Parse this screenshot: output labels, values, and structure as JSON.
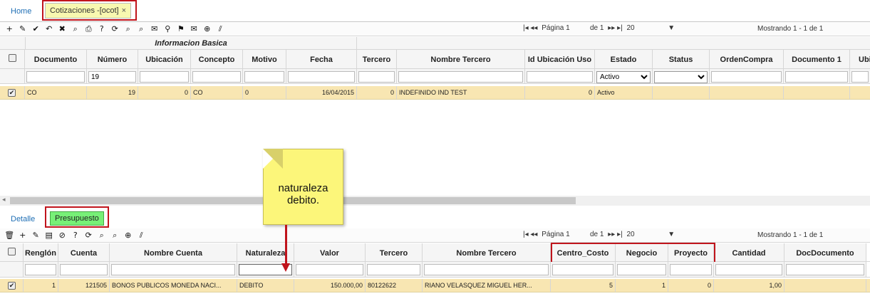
{
  "tabs": {
    "home": "Home",
    "active": "Cotizaciones -[ocot]",
    "close": "×"
  },
  "toolbar1": {
    "icons": [
      "+",
      "✎",
      "✔",
      "↶",
      "✖",
      "⌕",
      "⎙",
      "?",
      "⟳",
      "⌕",
      "⌕",
      "✉",
      "⚲",
      "⚑",
      "✉",
      "⊕",
      "⫽"
    ],
    "icon_names": [
      "add-icon",
      "edit-icon",
      "save-icon",
      "undo-icon",
      "delete-icon",
      "search-icon",
      "print-icon",
      "help-icon",
      "refresh-icon",
      "zoom-in-icon",
      "zoom-out-icon",
      "comment-icon",
      "user-icon",
      "pin-icon",
      "mail-icon",
      "plus-circle-icon",
      "slash-icon"
    ],
    "pager_first": "|◂ ◂◂",
    "pagina": "Página 1",
    "de": "de 1",
    "pager_next": "▸▸ ▸|",
    "page_size": "20",
    "dropdown": "▼",
    "showing": "Mostrando 1 - 1 de 1"
  },
  "main_grid": {
    "group_header": "Informacion Basica",
    "columns": [
      "Documento",
      "Número",
      "Ubicación",
      "Concepto",
      "Motivo",
      "Fecha",
      "Tercero",
      "Nombre Tercero",
      "Id Ubicación Uso",
      "Estado",
      "Status",
      "OrdenCompra",
      "Documento 1",
      "Ubi"
    ],
    "filters": {
      "numero": "19",
      "estado": "Activo",
      "status": ""
    },
    "row": {
      "documento": "CO",
      "numero": "19",
      "ubicacion": "0",
      "concepto": "CO",
      "motivo": "0",
      "fecha": "16/04/2015",
      "tercero": "0",
      "nombre_tercero": "INDEFINIDO IND TEST",
      "id_ubicacion_uso": "0",
      "estado": "Activo",
      "check": "✔"
    }
  },
  "hscroll_arrow": "◂",
  "note": {
    "line1": "naturaleza",
    "line2": "debito."
  },
  "subtabs": {
    "detalle": "Detalle",
    "presupuesto": "Presupuesto"
  },
  "toolbar2": {
    "icons": [
      "🗑",
      "+",
      "✎",
      "▤",
      "⊘",
      "?",
      "⟳",
      "⌕",
      "⌕",
      "⊕",
      "⫽"
    ],
    "icon_names": [
      "trash-icon",
      "add-icon",
      "edit-icon",
      "list-icon",
      "cancel-icon",
      "help-icon",
      "refresh-icon",
      "zoom-in-icon",
      "zoom-out-icon",
      "plus-circle-icon",
      "slash-icon"
    ],
    "pager_first": "|◂ ◂◂",
    "pagina": "Página 1",
    "de": "de 1",
    "pager_next": "▸▸ ▸|",
    "page_size": "20",
    "dropdown": "▼",
    "showing": "Mostrando 1 - 1 de 1"
  },
  "detail_grid": {
    "columns": [
      "Renglón",
      "Cuenta",
      "Nombre Cuenta",
      "Naturaleza",
      "Valor",
      "Tercero",
      "Nombre Tercero",
      "Centro_Costo",
      "Negocio",
      "Proyecto",
      "Cantidad",
      "DocDocumento"
    ],
    "row": {
      "renglon": "1",
      "cuenta": "121505",
      "nombre_cuenta": "BONOS PUBLICOS MONEDA NACI...",
      "naturaleza": "DEBITO",
      "valor": "150.000,00",
      "tercero": "80122622",
      "nombre_tercero": "RIANO VELASQUEZ MIGUEL HER...",
      "centro_costo": "5",
      "negocio": "1",
      "proyecto": "0",
      "cantidad": "1,00",
      "check": "✔"
    }
  }
}
